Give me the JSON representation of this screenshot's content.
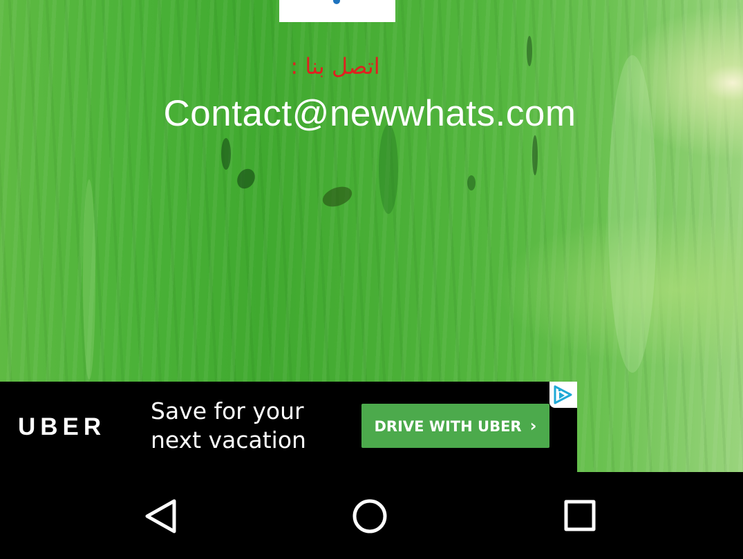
{
  "page": {
    "contact_label": "اتصل بنا :",
    "contact_email": "Contact@newwhats.com"
  },
  "ad": {
    "brand": "UBER",
    "headline_line1": "Save for your",
    "headline_line2": "next vacation",
    "cta_label": "DRIVE WITH UBER",
    "cta_chevron": "›",
    "adchoices_icon": "adchoices-icon",
    "cta_color": "#4caa4c"
  },
  "navbar": {
    "back_icon": "back-triangle-icon",
    "home_icon": "home-circle-icon",
    "recents_icon": "recents-square-icon"
  },
  "colors": {
    "contact_label": "#e02020",
    "contact_email": "#ffffff",
    "background_accent": "#4bb238"
  }
}
